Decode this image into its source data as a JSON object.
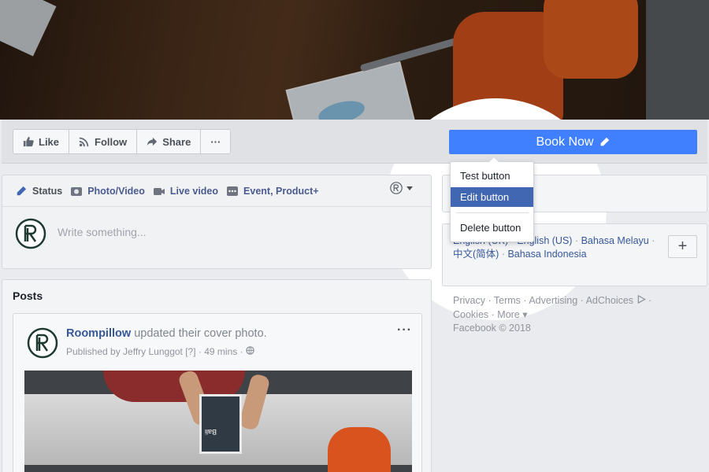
{
  "page_actions": {
    "like_label": "Like",
    "follow_label": "Follow",
    "share_label": "Share",
    "more_label": "···",
    "book_now_label": "Book Now"
  },
  "dropdown": {
    "items": [
      {
        "label": "Test button"
      },
      {
        "label": "Edit button"
      },
      {
        "label": "Delete button"
      }
    ],
    "active_index": 1
  },
  "composer": {
    "tabs": [
      {
        "label": "Status",
        "icon": "pencil-icon"
      },
      {
        "label": "Photo/Video",
        "icon": "camera-icon"
      },
      {
        "label": "Live video",
        "icon": "video-camera-icon"
      },
      {
        "label": "Event, Product+",
        "icon": "more-options-icon"
      }
    ],
    "placeholder": "Write something..."
  },
  "posts": {
    "title": "Posts",
    "post": {
      "author": "Roompillow",
      "action": " updated their cover photo.",
      "published_by": "Published by Jeffry Lunggot [?] · 49 mins · ",
      "book_text": "Bali"
    }
  },
  "languages": {
    "items": [
      "English (UK)",
      "English (US)",
      "Bahasa Melayu",
      "中文(简体)",
      "Bahasa Indonesia"
    ],
    "add_label": "+"
  },
  "footer": {
    "links": [
      "Privacy",
      "Terms",
      "Advertising",
      "AdChoices",
      "Cookies",
      "More"
    ],
    "copyright": "Facebook © 2018"
  },
  "colors": {
    "accent_blue": "#4080ff",
    "link_blue": "#365899",
    "menu_active": "#4267b2",
    "background": "#e9ebee"
  }
}
